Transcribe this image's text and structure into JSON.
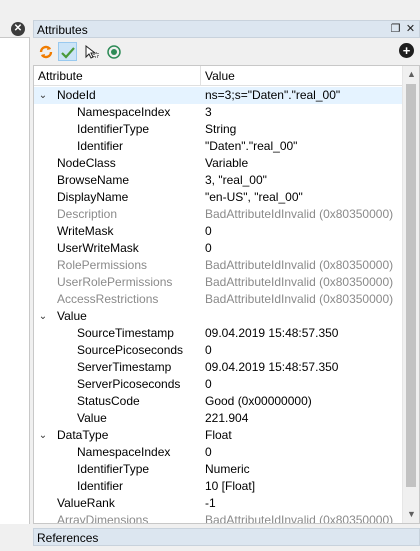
{
  "app": {
    "close_glyph": "✕"
  },
  "attributes_panel": {
    "title": "Attributes",
    "float_glyph": "❐",
    "close_glyph": "✕",
    "add_glyph": "+",
    "toolbar": {
      "refresh_icon": "refresh-icon",
      "check_icon": "check-icon",
      "cursor_icon": "cursor-select-icon",
      "record_icon": "record-icon"
    },
    "columns": {
      "attribute": "Attribute",
      "value": "Value"
    },
    "rows": [
      {
        "name": "NodeId",
        "value": "ns=3;s=\"Daten\".\"real_00\"",
        "level": 0,
        "expanded": true,
        "selected": true,
        "dim": false
      },
      {
        "name": "NamespaceIndex",
        "value": "3",
        "level": 1,
        "dim": false
      },
      {
        "name": "IdentifierType",
        "value": "String",
        "level": 1,
        "dim": false
      },
      {
        "name": "Identifier",
        "value": "\"Daten\".\"real_00\"",
        "level": 1,
        "dim": false
      },
      {
        "name": "NodeClass",
        "value": "Variable",
        "level": 0,
        "dim": false
      },
      {
        "name": "BrowseName",
        "value": "3, \"real_00\"",
        "level": 0,
        "dim": false
      },
      {
        "name": "DisplayName",
        "value": "\"en-US\", \"real_00\"",
        "level": 0,
        "dim": false
      },
      {
        "name": "Description",
        "value": "BadAttributeIdInvalid (0x80350000)",
        "level": 0,
        "dim": true
      },
      {
        "name": "WriteMask",
        "value": "0",
        "level": 0,
        "dim": false
      },
      {
        "name": "UserWriteMask",
        "value": "0",
        "level": 0,
        "dim": false
      },
      {
        "name": "RolePermissions",
        "value": "BadAttributeIdInvalid (0x80350000)",
        "level": 0,
        "dim": true
      },
      {
        "name": "UserRolePermissions",
        "value": "BadAttributeIdInvalid (0x80350000)",
        "level": 0,
        "dim": true
      },
      {
        "name": "AccessRestrictions",
        "value": "BadAttributeIdInvalid (0x80350000)",
        "level": 0,
        "dim": true
      },
      {
        "name": "Value",
        "value": "",
        "level": 0,
        "expanded": true,
        "dim": false
      },
      {
        "name": "SourceTimestamp",
        "value": "09.04.2019 15:48:57.350",
        "level": 1,
        "dim": false
      },
      {
        "name": "SourcePicoseconds",
        "value": "0",
        "level": 1,
        "dim": false
      },
      {
        "name": "ServerTimestamp",
        "value": "09.04.2019 15:48:57.350",
        "level": 1,
        "dim": false
      },
      {
        "name": "ServerPicoseconds",
        "value": "0",
        "level": 1,
        "dim": false
      },
      {
        "name": "StatusCode",
        "value": "Good (0x00000000)",
        "level": 1,
        "dim": false
      },
      {
        "name": "Value",
        "value": "221.904",
        "level": 1,
        "dim": false
      },
      {
        "name": "DataType",
        "value": "Float",
        "level": 0,
        "expanded": true,
        "dim": false
      },
      {
        "name": "NamespaceIndex",
        "value": "0",
        "level": 1,
        "dim": false
      },
      {
        "name": "IdentifierType",
        "value": "Numeric",
        "level": 1,
        "dim": false
      },
      {
        "name": "Identifier",
        "value": "10 [Float]",
        "level": 1,
        "dim": false
      },
      {
        "name": "ValueRank",
        "value": "-1",
        "level": 0,
        "dim": false
      },
      {
        "name": "ArrayDimensions",
        "value": "BadAttributeIdInvalid (0x80350000)",
        "level": 0,
        "dim": true
      }
    ],
    "scroll": {
      "up_glyph": "▲",
      "down_glyph": "▼"
    }
  },
  "references_panel": {
    "title": "References"
  },
  "colors": {
    "header_bg": "#dce6f0",
    "selection_bg": "#e5f3ff",
    "dim_text": "#8a8a8a",
    "accent_orange": "#f07c00",
    "accent_green": "#2e8b57"
  }
}
